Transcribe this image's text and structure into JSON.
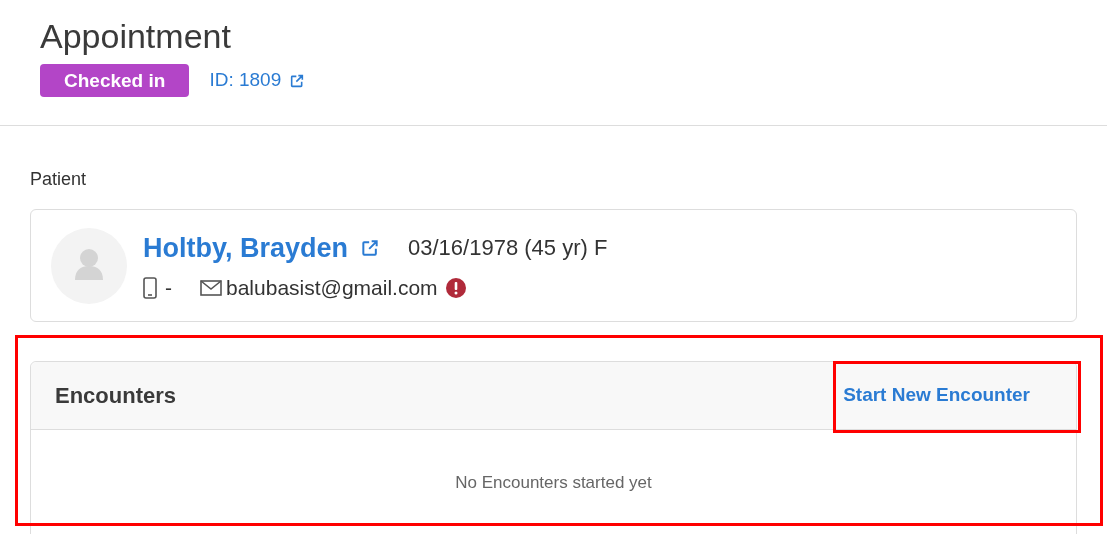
{
  "header": {
    "title": "Appointment",
    "status": "Checked in",
    "id_link": "ID: 1809"
  },
  "patient": {
    "label": "Patient",
    "name": "Holtby, Brayden",
    "dob": "03/16/1978 (45 yr) F",
    "phone": "-",
    "email": "balubasist@gmail.com",
    "email_warning": true
  },
  "encounters": {
    "title": "Encounters",
    "highlighted": true,
    "action": {
      "label": "Start New Encounter",
      "highlighted": true
    },
    "empty_text": "No Encounters started yet"
  }
}
